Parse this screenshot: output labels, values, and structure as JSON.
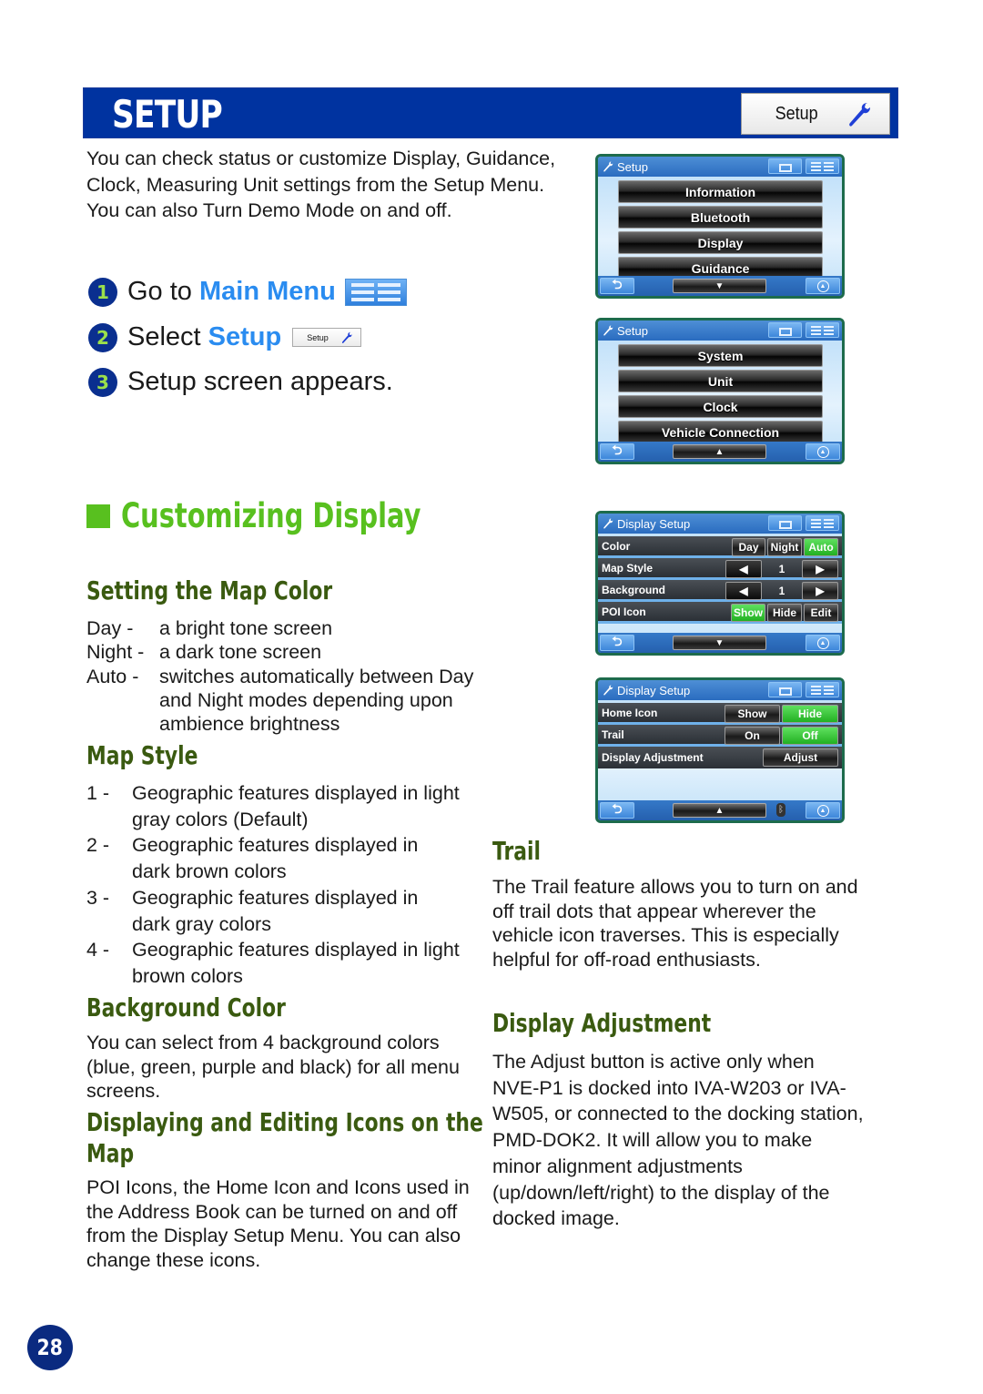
{
  "header": {
    "title": "SETUP",
    "setup_button_label": "Setup",
    "setup_button_icon": "wrench-icon"
  },
  "intro": "You can check status or customize Display, Guidance, Clock, Measuring Unit settings from the Setup Menu. You can also Turn Demo Mode on and off.",
  "steps": [
    {
      "num": "1",
      "prefix": "Go to ",
      "highlight": "Main Menu",
      "suffix": "",
      "icon": "main-menu-icon"
    },
    {
      "num": "2",
      "prefix": "Select ",
      "highlight": "Setup",
      "suffix": "",
      "icon": "setup-button-icon",
      "icon_label": "Setup"
    },
    {
      "num": "3",
      "prefix": "Setup screen appears.",
      "highlight": "",
      "suffix": ""
    }
  ],
  "section": {
    "title": "Customizing Display"
  },
  "map_color": {
    "heading": "Setting the Map Color",
    "items": [
      {
        "term": "Day -",
        "desc": "a bright tone screen"
      },
      {
        "term": "Night -",
        "desc": "a dark tone screen"
      },
      {
        "term": "Auto -",
        "desc": "switches automatically between Day and Night modes depending upon ambience brightness"
      }
    ]
  },
  "map_style": {
    "heading": "Map Style",
    "items": [
      {
        "n": "1 -",
        "d": "Geographic features displayed in light gray colors (Default)"
      },
      {
        "n": "2 -",
        "d": "Geographic features displayed in dark brown colors"
      },
      {
        "n": "3 -",
        "d": "Geographic features displayed in dark gray colors"
      },
      {
        "n": "4 -",
        "d": "Geographic features displayed in light brown colors"
      }
    ]
  },
  "background_color": {
    "heading": "Background Color",
    "body": "You can select from 4 background colors (blue, green, purple and black) for all menu screens."
  },
  "icons_section": {
    "heading_line1": "Displaying and Editing Icons on the",
    "heading_line2": "Map",
    "body": "POI Icons, the Home Icon and Icons used in the Address Book can be turned on and off from the Display Setup Menu. You can also change these icons."
  },
  "trail": {
    "heading": "Trail",
    "body": "The Trail feature allows you to turn on and off trail dots that appear wherever the vehicle icon traverses. This is especially helpful for off-road enthusiasts."
  },
  "display_adjustment": {
    "heading": "Display Adjustment",
    "body": "The Adjust button is active only when NVE-P1 is docked into IVA-W203 or IVA-W505, or connected to the docking station, PMD-DOK2. It will allow you to make minor alignment adjustments (up/down/left/right) to the display of the docked image."
  },
  "screens": {
    "setup1": {
      "title": "Setup",
      "items": [
        "Information",
        "Bluetooth",
        "Display",
        "Guidance"
      ],
      "scroll": "▼"
    },
    "setup2": {
      "title": "Setup",
      "items": [
        "System",
        "Unit",
        "Clock",
        "Vehicle Connection"
      ],
      "scroll": "▲"
    },
    "display1": {
      "title": "Display Setup",
      "rows": [
        {
          "label": "Color",
          "options": [
            "Day",
            "Night",
            "Auto"
          ],
          "selected": "Auto"
        },
        {
          "label": "Map Style",
          "value": "1",
          "left": "◀",
          "right": "▶"
        },
        {
          "label": "Background",
          "value": "1",
          "left": "◀",
          "right": "▶"
        },
        {
          "label": "POI Icon",
          "options": [
            "Show",
            "Hide",
            "Edit"
          ],
          "selected": "Show"
        }
      ],
      "scroll": "▼"
    },
    "display2": {
      "title": "Display Setup",
      "rows": [
        {
          "label": "Home Icon",
          "options": [
            "Show",
            "Hide"
          ],
          "selected": "Hide"
        },
        {
          "label": "Trail",
          "options": [
            "On",
            "Off"
          ],
          "selected": "Off"
        },
        {
          "label": "Display Adjustment",
          "button": "Adjust"
        }
      ],
      "scroll": "▲",
      "status_icon": "bluetooth-icon"
    },
    "back_glyph": "⮌",
    "nav_glyph": "▲"
  },
  "colors": {
    "header_blue": "#0033a0",
    "accent_green": "#58c01f",
    "heading_dark_green": "#3a5a10",
    "highlight_blue": "#2a8cf0",
    "selected_green": "#22b022"
  },
  "page_number": "28"
}
